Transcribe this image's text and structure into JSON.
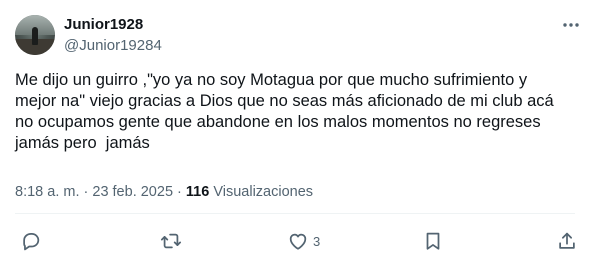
{
  "user": {
    "name": "Junior1928",
    "handle": "@Junior19284"
  },
  "tweet": {
    "text": "Me dijo un guirro ,\"yo ya no soy Motagua por que mucho sufrimiento y\nmejor na\" viejo gracias a Dios que no seas más aficionado de mi club acá\nno ocupamos gente que abandone en los malos momentos no regreses\njamás pero  jamás",
    "time": "8:18 a. m.",
    "separator": " · ",
    "date": "23 feb. 2025",
    "views_count": "116",
    "views_label": " Visualizaciones"
  },
  "actions": {
    "like_count": "3"
  },
  "icons": {
    "more": "more-horizontal-icon",
    "reply": "reply-bubble-icon",
    "retweet": "retweet-arrows-icon",
    "like": "heart-icon",
    "bookmark": "bookmark-icon",
    "share": "share-upload-icon"
  },
  "colors": {
    "text_primary": "#0f1419",
    "text_secondary": "#536471",
    "divider": "#eff3f4"
  }
}
